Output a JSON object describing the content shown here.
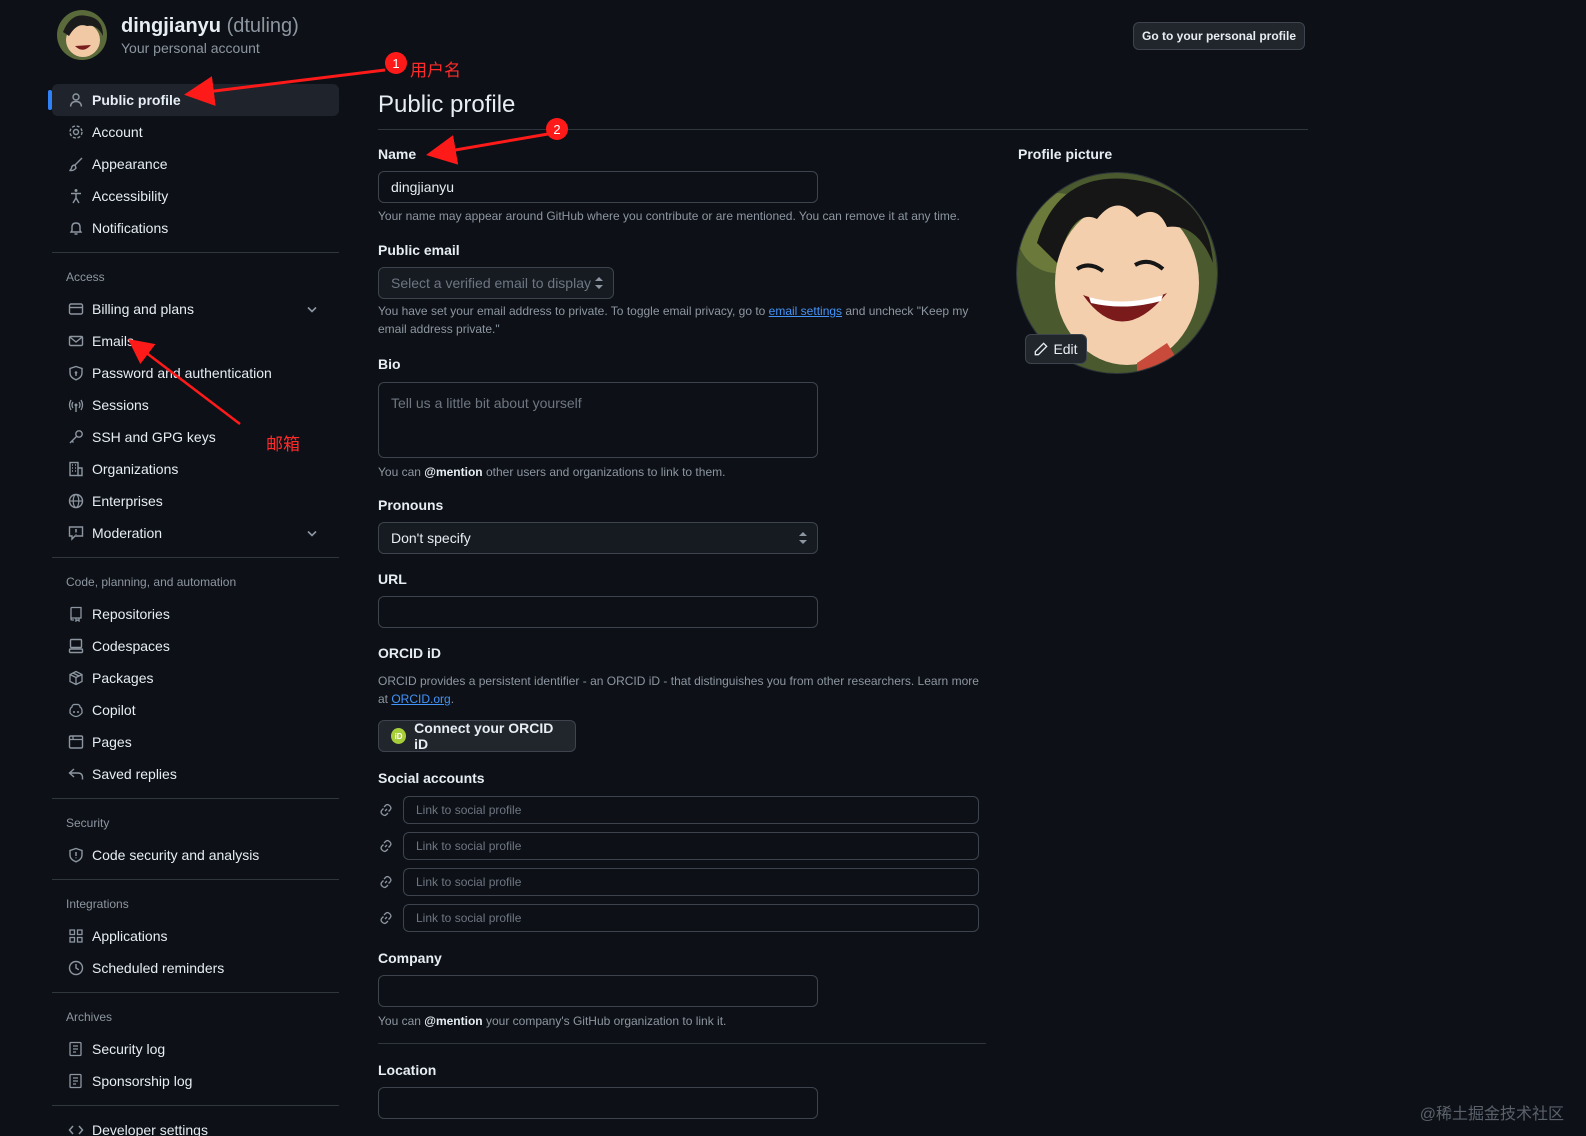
{
  "header": {
    "name": "dingjianyu",
    "login": "(dtuling)",
    "subtitle": "Your personal account",
    "go_profile_button": "Go to your personal profile"
  },
  "sidebar": {
    "top_items": [
      {
        "label": "Public profile",
        "icon": "person-icon",
        "active": true
      },
      {
        "label": "Account",
        "icon": "gear-icon"
      },
      {
        "label": "Appearance",
        "icon": "paintbrush-icon"
      },
      {
        "label": "Accessibility",
        "icon": "accessibility-icon"
      },
      {
        "label": "Notifications",
        "icon": "bell-icon"
      }
    ],
    "access_heading": "Access",
    "access_items": [
      {
        "label": "Billing and plans",
        "icon": "credit-card-icon",
        "expandable": true
      },
      {
        "label": "Emails",
        "icon": "mail-icon"
      },
      {
        "label": "Password and authentication",
        "icon": "shield-lock-icon"
      },
      {
        "label": "Sessions",
        "icon": "broadcast-icon"
      },
      {
        "label": "SSH and GPG keys",
        "icon": "key-icon"
      },
      {
        "label": "Organizations",
        "icon": "organization-icon"
      },
      {
        "label": "Enterprises",
        "icon": "globe-icon"
      },
      {
        "label": "Moderation",
        "icon": "report-icon",
        "expandable": true
      }
    ],
    "code_heading": "Code, planning, and automation",
    "code_items": [
      {
        "label": "Repositories",
        "icon": "repo-icon"
      },
      {
        "label": "Codespaces",
        "icon": "codespaces-icon"
      },
      {
        "label": "Packages",
        "icon": "package-icon"
      },
      {
        "label": "Copilot",
        "icon": "copilot-icon"
      },
      {
        "label": "Pages",
        "icon": "browser-icon"
      },
      {
        "label": "Saved replies",
        "icon": "reply-icon"
      }
    ],
    "security_heading": "Security",
    "security_items": [
      {
        "label": "Code security and analysis",
        "icon": "shield-icon"
      }
    ],
    "integrations_heading": "Integrations",
    "integrations_items": [
      {
        "label": "Applications",
        "icon": "apps-icon"
      },
      {
        "label": "Scheduled reminders",
        "icon": "clock-icon"
      }
    ],
    "archives_heading": "Archives",
    "archives_items": [
      {
        "label": "Security log",
        "icon": "log-icon"
      },
      {
        "label": "Sponsorship log",
        "icon": "log-icon"
      }
    ],
    "developer_item": {
      "label": "Developer settings",
      "icon": "code-icon"
    }
  },
  "main": {
    "title": "Public profile",
    "name_label": "Name",
    "name_value": "dingjianyu",
    "name_note": "Your name may appear around GitHub where you contribute or are mentioned. You can remove it at any time.",
    "email_label": "Public email",
    "email_placeholder": "Select a verified email to display",
    "email_note_1": "You have set your email address to private. To toggle email privacy, go to ",
    "email_note_link": "email settings",
    "email_note_2": " and uncheck \"Keep my email address private.\"",
    "bio_label": "Bio",
    "bio_placeholder": "Tell us a little bit about yourself",
    "bio_note_1": "You can ",
    "bio_note_bold": "@mention",
    "bio_note_2": " other users and organizations to link to them.",
    "pronouns_label": "Pronouns",
    "pronouns_value": "Don't specify",
    "url_label": "URL",
    "orcid_label": "ORCID iD",
    "orcid_note": "ORCID provides a persistent identifier - an ORCID iD - that distinguishes you from other researchers. Learn more at ",
    "orcid_link": "ORCID.org",
    "orcid_badge": "iD",
    "orcid_button": "Connect your ORCID iD",
    "social_label": "Social accounts",
    "social_placeholders": [
      "Link to social profile",
      "Link to social profile",
      "Link to social profile",
      "Link to social profile"
    ],
    "company_label": "Company",
    "company_note_1": "You can ",
    "company_note_bold": "@mention",
    "company_note_2": " your company's GitHub organization to link it.",
    "location_label": "Location"
  },
  "profile_picture": {
    "label": "Profile picture",
    "edit_button": "Edit"
  },
  "annotations": {
    "badge_1": "1",
    "label_1": "用户名",
    "badge_2": "2",
    "label_email": "邮箱"
  },
  "watermark": "@稀土掘金技术社区",
  "colors": {
    "background": "#0d1117",
    "accent": "#2f81f7",
    "annotation": "#ff1a1a"
  }
}
